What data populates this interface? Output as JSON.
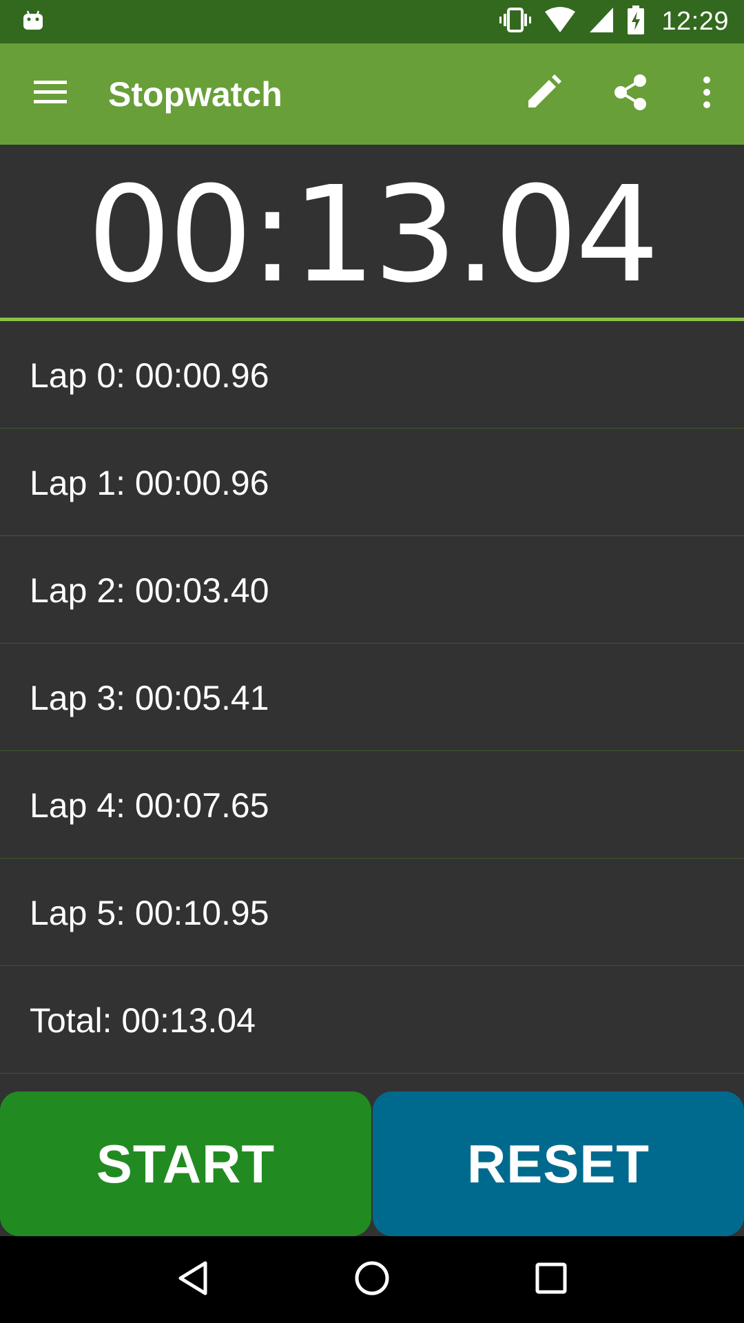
{
  "status_bar": {
    "time": "12:29",
    "icons": [
      "android-debug-icon",
      "vibrate-icon",
      "wifi-icon",
      "cell-signal-icon",
      "battery-charging-icon"
    ]
  },
  "app_bar": {
    "title": "Stopwatch",
    "icons": [
      "menu-icon",
      "edit-icon",
      "share-icon",
      "more-vert-icon"
    ],
    "color": "#689f38",
    "status_color": "#33691e"
  },
  "timer": {
    "display": "00:13.04",
    "accent": "#8bc34a"
  },
  "laps": [
    {
      "text": "Lap 0: 00:00.96"
    },
    {
      "text": "Lap 1: 00:00.96"
    },
    {
      "text": "Lap 2: 00:03.40"
    },
    {
      "text": "Lap 3: 00:05.41"
    },
    {
      "text": "Lap 4: 00:07.65"
    },
    {
      "text": "Lap 5: 00:10.95"
    },
    {
      "text": "Total: 00:13.04"
    }
  ],
  "controls": {
    "start_label": "START",
    "reset_label": "RESET",
    "start_color": "#218b22",
    "reset_color": "#006a8e"
  },
  "nav_bar": {
    "icons": [
      "back-icon",
      "home-icon",
      "recents-icon"
    ]
  }
}
